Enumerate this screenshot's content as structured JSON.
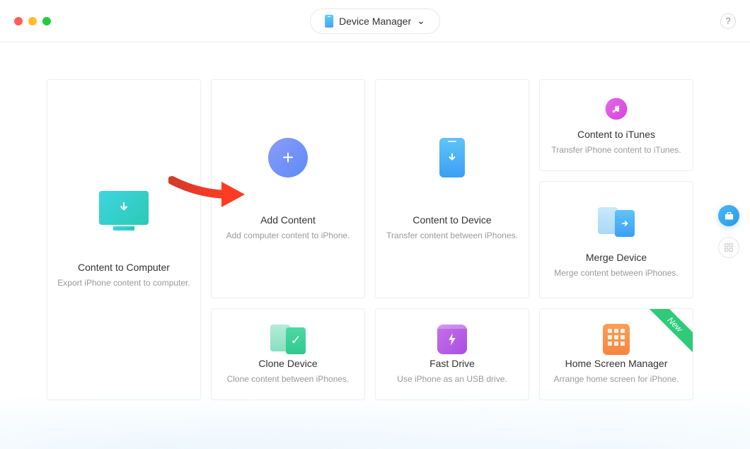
{
  "header": {
    "dropdown_label": "Device Manager",
    "help_label": "?"
  },
  "cards": {
    "to_computer": {
      "title": "Content to Computer",
      "desc": "Export iPhone content to computer."
    },
    "add_content": {
      "title": "Add Content",
      "desc": "Add computer content to iPhone."
    },
    "to_device": {
      "title": "Content to Device",
      "desc": "Transfer content between iPhones."
    },
    "to_itunes": {
      "title": "Content to iTunes",
      "desc": "Transfer iPhone content to iTunes."
    },
    "merge": {
      "title": "Merge Device",
      "desc": "Merge content between iPhones."
    },
    "clone": {
      "title": "Clone Device",
      "desc": "Clone content between iPhones."
    },
    "fast_drive": {
      "title": "Fast Drive",
      "desc": "Use iPhone as an USB drive."
    },
    "home_screen": {
      "title": "Home Screen Manager",
      "desc": "Arrange home screen for iPhone.",
      "badge": "New"
    }
  }
}
